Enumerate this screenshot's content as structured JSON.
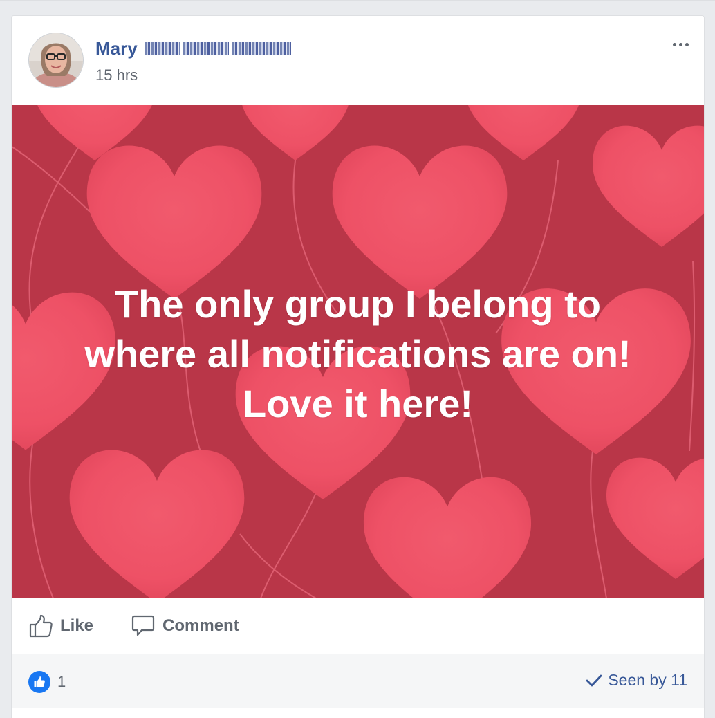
{
  "post": {
    "author": {
      "name_visible": "Mary",
      "name_redacted": true
    },
    "timestamp": "15 hrs",
    "background_colors": {
      "base": "#b93648",
      "heart": "#f05468"
    },
    "text_lines": [
      "The only group I belong to",
      "where all notifications are on!",
      "Love it here!"
    ]
  },
  "actions": {
    "like_label": "Like",
    "comment_label": "Comment"
  },
  "reactions": {
    "count": "1",
    "seen_by_label": "Seen by 11"
  },
  "icons": {
    "more": "more-options-icon",
    "like": "thumbs-up-icon",
    "comment": "speech-bubble-icon",
    "like_badge": "like-reaction-icon",
    "seen": "checkmark-icon"
  }
}
